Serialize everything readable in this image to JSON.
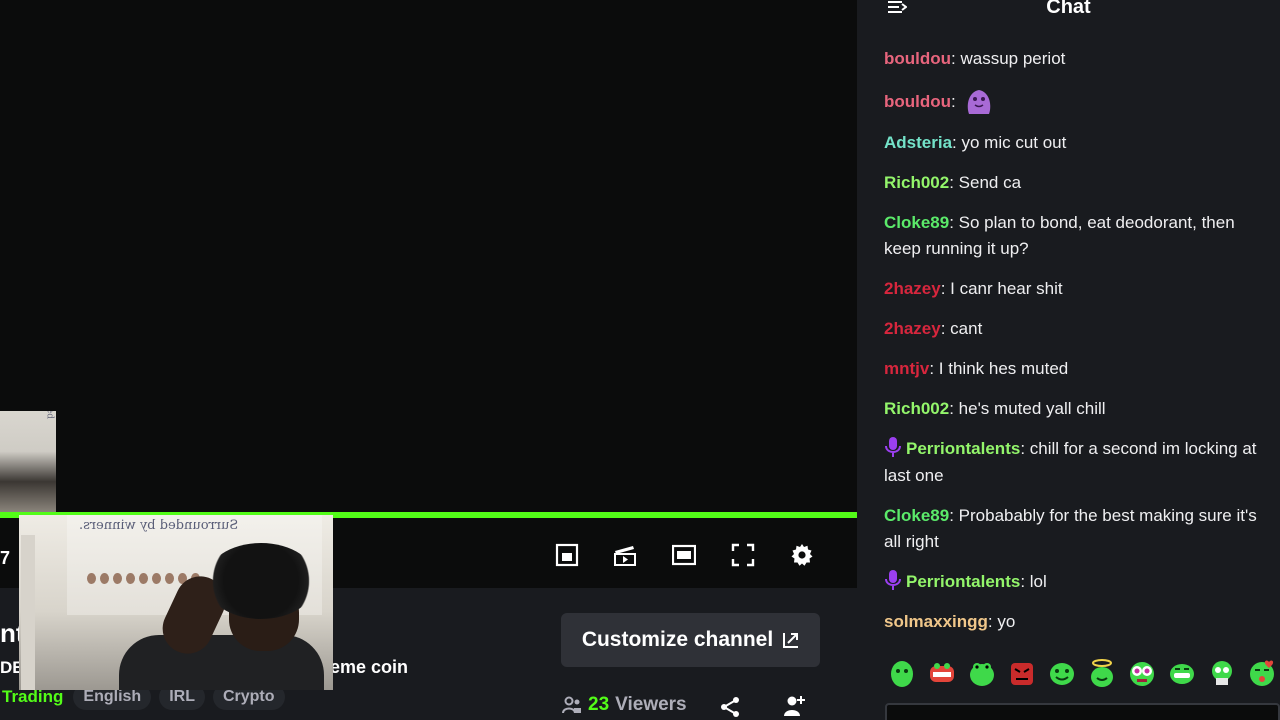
{
  "player": {
    "mini_thumb_caption": "Surrounded",
    "time_fragment": "7",
    "progress_color": "#53fc18"
  },
  "webcam": {
    "banner_text": "Surrounded by winners."
  },
  "controls": {
    "icons": [
      "picture-in-picture-icon",
      "clip-icon",
      "theater-mode-icon",
      "fullscreen-icon",
      "settings-icon"
    ]
  },
  "stream_info": {
    "title_fragment": "nt",
    "desc_fragment": "DE",
    "desc_tail": "eme coin",
    "category": "Trading",
    "tags": [
      "English",
      "IRL",
      "Crypto"
    ],
    "customize_label": "Customize channel",
    "viewer_count": "23",
    "viewers_label": "Viewers"
  },
  "chat": {
    "title": "Chat",
    "messages": [
      {
        "user": "bouldou",
        "color": "#e8657d",
        "text": "wassup periot",
        "emote": false,
        "badge": false
      },
      {
        "user": "bouldou",
        "color": "#e8657d",
        "text": "",
        "emote": true,
        "badge": false
      },
      {
        "user": "Adsteria",
        "color": "#74e3c9",
        "text": "yo mic cut out",
        "emote": false,
        "badge": false
      },
      {
        "user": "Rich002",
        "color": "#93f56b",
        "text": "Send ca",
        "emote": false,
        "badge": false
      },
      {
        "user": "Cloke89",
        "color": "#5bea6a",
        "text": "So plan to bond, eat deodorant, then keep running it up?",
        "emote": false,
        "badge": false
      },
      {
        "user": "2hazey",
        "color": "#d7263d",
        "text": "I canr hear shit",
        "emote": false,
        "badge": false
      },
      {
        "user": "2hazey",
        "color": "#d7263d",
        "text": "cant",
        "emote": false,
        "badge": false
      },
      {
        "user": "mntjv",
        "color": "#d7263d",
        "text": "I think hes muted",
        "emote": false,
        "badge": false
      },
      {
        "user": "Rich002",
        "color": "#93f56b",
        "text": "he's muted yall chill",
        "emote": false,
        "badge": false
      },
      {
        "user": "Perriontalents",
        "color": "#93f56b",
        "text": "chill for a second im locking at last one",
        "emote": false,
        "badge": true
      },
      {
        "user": "Cloke89",
        "color": "#5bea6a",
        "text": "Probabably for the best making sure it's all right",
        "emote": false,
        "badge": false
      },
      {
        "user": "Perriontalents",
        "color": "#93f56b",
        "text": "lol",
        "emote": false,
        "badge": true
      },
      {
        "user": "solmaxxingg",
        "color": "#f0c78a",
        "text": "yo",
        "emote": false,
        "badge": false
      }
    ],
    "emote_bar": [
      "green-blob-emote",
      "red-chomp-emote",
      "green-frog-emote",
      "angry-red-emote",
      "green-smile-emote",
      "angel-emote",
      "pink-eyes-emote",
      "grin-emote",
      "skull-emote",
      "kiss-emote"
    ]
  }
}
